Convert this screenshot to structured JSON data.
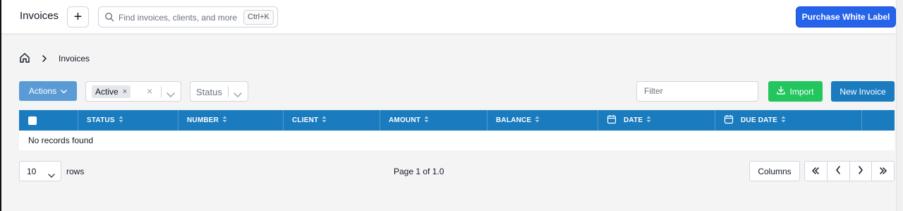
{
  "header": {
    "title": "Invoices",
    "add_label": "+",
    "search_placeholder": "Find invoices, clients, and more",
    "search_shortcut": "Ctrl+K",
    "purchase_label": "Purchase White Label"
  },
  "breadcrumb": {
    "current": "Invoices"
  },
  "toolbar": {
    "actions_label": "Actions",
    "filter_chip": "Active",
    "status_placeholder": "Status",
    "filter_placeholder": "Filter",
    "import_label": "Import",
    "new_invoice_label": "New Invoice"
  },
  "table": {
    "columns": [
      "STATUS",
      "NUMBER",
      "CLIENT",
      "AMOUNT",
      "BALANCE",
      "DATE",
      "DUE DATE"
    ],
    "empty_message": "No records found"
  },
  "footer": {
    "rows_value": "10",
    "rows_label": "rows",
    "page_info": "Page 1 of 1.0",
    "columns_label": "Columns"
  },
  "colors": {
    "primary": "#1a7bbf",
    "purchase": "#2563eb",
    "import": "#22c55e",
    "actions": "#5b9bd5"
  }
}
